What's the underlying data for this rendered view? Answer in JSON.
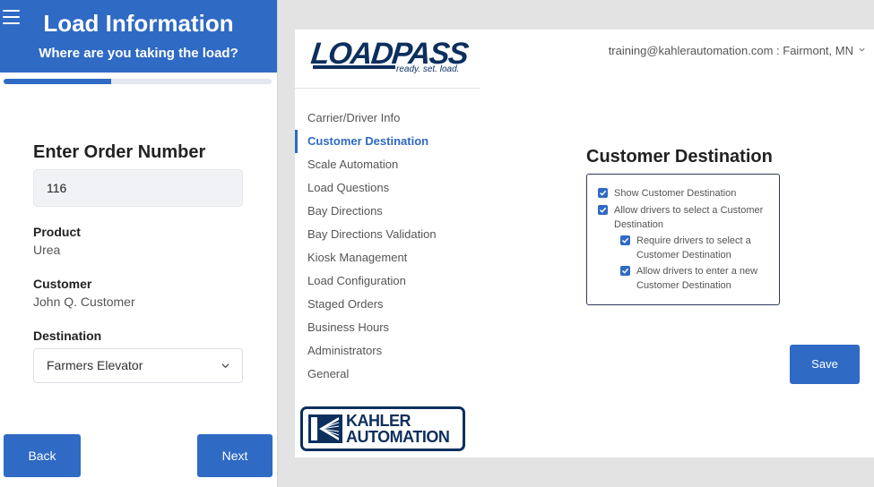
{
  "mobile": {
    "title": "Load Information",
    "subtitle": "Where are you taking the load?",
    "progress": 0.4,
    "order_heading": "Enter Order Number",
    "order_value": "116",
    "product_label": "Product",
    "product_value": "Urea",
    "customer_label": "Customer",
    "customer_value": "John Q. Customer",
    "destination_label": "Destination",
    "destination_value": "Farmers Elevator",
    "back_label": "Back",
    "next_label": "Next",
    "accent": "#2f6ac4"
  },
  "admin": {
    "logo_text": "LOADPASS",
    "logo_tagline": "ready. set. load.",
    "user": "training@kahlerautomation.com : Fairmont, MN",
    "nav": [
      {
        "label": "Carrier/Driver Info"
      },
      {
        "label": "Customer Destination"
      },
      {
        "label": "Scale Automation"
      },
      {
        "label": "Load Questions"
      },
      {
        "label": "Bay Directions"
      },
      {
        "label": "Bay Directions Validation"
      },
      {
        "label": "Kiosk Management"
      },
      {
        "label": "Load Configuration"
      },
      {
        "label": "Staged Orders"
      },
      {
        "label": "Business Hours"
      },
      {
        "label": "Administrators"
      },
      {
        "label": "General"
      }
    ],
    "active_nav": "Customer Destination",
    "section_title": "Customer Destination",
    "options": [
      {
        "label": "Show Customer Destination",
        "checked": true
      },
      {
        "label": "Allow drivers to select a Customer Destination",
        "checked": true
      },
      {
        "label": "Require drivers to select a Customer Destination",
        "checked": true
      },
      {
        "label": "Allow drivers to enter a new Customer Destination",
        "checked": true
      }
    ],
    "save_label": "Save",
    "kahler_line1": "KAHLER",
    "kahler_line2": "AUTOMATION"
  }
}
